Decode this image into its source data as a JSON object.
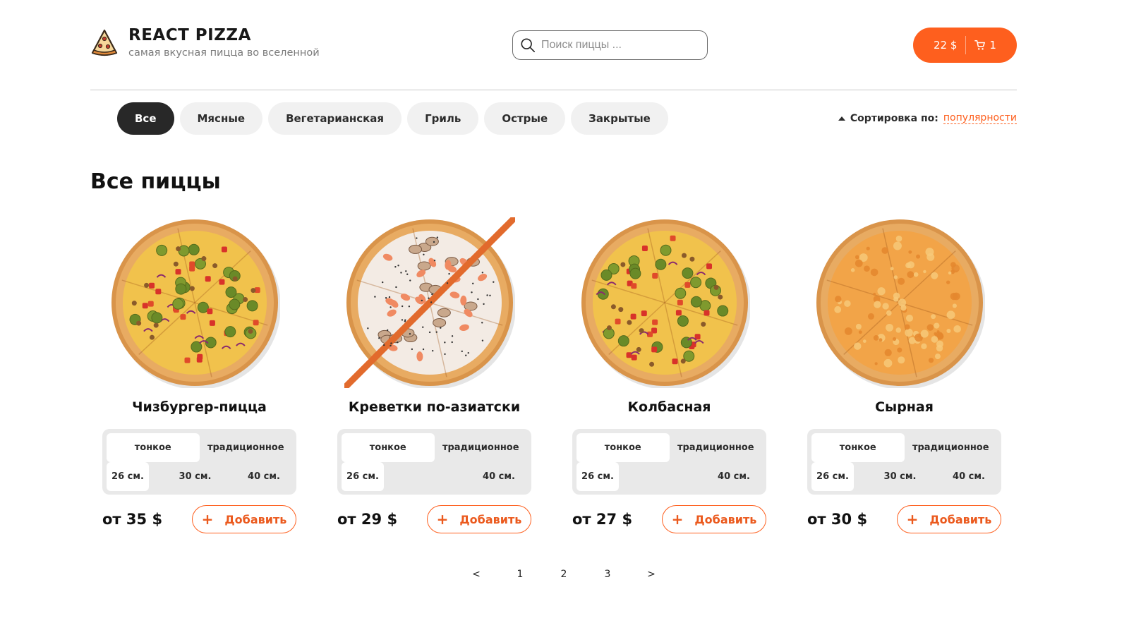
{
  "header": {
    "title": "REACT PIZZA",
    "subtitle": "самая вкусная пицца во вселенной",
    "search_placeholder": "Поиск пиццы ...",
    "cart": {
      "total": "22 $",
      "count": "1"
    }
  },
  "categories": [
    {
      "label": "Все",
      "active": true
    },
    {
      "label": "Мясные",
      "active": false
    },
    {
      "label": "Вегетарианская",
      "active": false
    },
    {
      "label": "Гриль",
      "active": false
    },
    {
      "label": "Острые",
      "active": false
    },
    {
      "label": "Закрытые",
      "active": false
    }
  ],
  "sort": {
    "label": "Сортировка по:",
    "value": "популярности"
  },
  "section_title": "Все пиццы",
  "pizzas": [
    {
      "name": "Чизбургер-пицца",
      "types": [
        "тонкое",
        "традиционное"
      ],
      "sizes": [
        "26 см.",
        "30 см.",
        "40 см."
      ],
      "price": "от 35 $",
      "add_label": "Добавить",
      "style": "loaded"
    },
    {
      "name": "Креветки по-азиатски",
      "types": [
        "тонкое",
        "традиционное"
      ],
      "sizes": [
        "26 см.",
        "",
        "40 см."
      ],
      "price": "от 29 $",
      "add_label": "Добавить",
      "style": "shrimp"
    },
    {
      "name": "Колбасная",
      "types": [
        "тонкое",
        "традиционное"
      ],
      "sizes": [
        "26 см.",
        "",
        "40 см."
      ],
      "price": "от 27 $",
      "add_label": "Добавить",
      "style": "loaded"
    },
    {
      "name": "Сырная",
      "types": [
        "тонкое",
        "традиционное"
      ],
      "sizes": [
        "26 см.",
        "30 см.",
        "40 см."
      ],
      "price": "от 30 $",
      "add_label": "Добавить",
      "style": "cheese"
    }
  ],
  "pagination": [
    "<",
    "1",
    "2",
    "3",
    ">"
  ],
  "colors": {
    "accent": "#fe5f1e",
    "dark": "#282828",
    "chip": "#f1f1f1"
  },
  "icons": {
    "logo": "pizza-slice-icon",
    "search": "search-icon",
    "cart": "cart-icon",
    "plus": "plus-icon"
  }
}
